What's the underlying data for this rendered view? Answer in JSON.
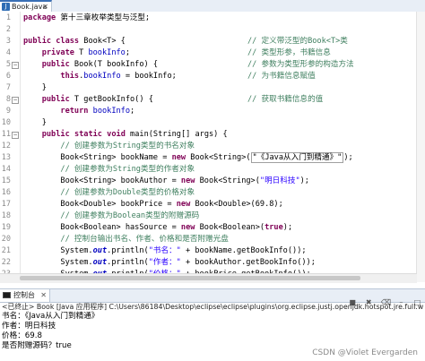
{
  "editor": {
    "tab_label": "Book.java",
    "tab_close": "✕",
    "highlighted_line": 27,
    "lines": [
      {
        "n": "1",
        "fold": "",
        "tokens": [
          {
            "t": "package",
            "c": "kw"
          },
          {
            "t": " 第十三章枚举类型与泛型;",
            "c": ""
          }
        ]
      },
      {
        "n": "2",
        "fold": "",
        "tokens": []
      },
      {
        "n": "3",
        "fold": "",
        "tokens": [
          {
            "t": "public",
            "c": "kw"
          },
          {
            "t": " ",
            "c": ""
          },
          {
            "t": "class",
            "c": "kw"
          },
          {
            "t": " Book<T> {",
            "c": ""
          }
        ],
        "comment": "// 定义带泛型的Book<T>类"
      },
      {
        "n": "4",
        "fold": "",
        "tokens": [
          {
            "t": "    ",
            "c": ""
          },
          {
            "t": "private",
            "c": "kw"
          },
          {
            "t": " T ",
            "c": ""
          },
          {
            "t": "bookInfo",
            "c": "field"
          },
          {
            "t": ";",
            "c": ""
          }
        ],
        "comment": "// 类型形参，书籍信息"
      },
      {
        "n": "5",
        "fold": "−",
        "tokens": [
          {
            "t": "    ",
            "c": ""
          },
          {
            "t": "public",
            "c": "kw"
          },
          {
            "t": " Book(T bookInfo) {",
            "c": ""
          }
        ],
        "comment": "// 参数为类型形参的构造方法"
      },
      {
        "n": "6",
        "fold": "",
        "tokens": [
          {
            "t": "        ",
            "c": ""
          },
          {
            "t": "this",
            "c": "kw"
          },
          {
            "t": ".",
            "c": ""
          },
          {
            "t": "bookInfo",
            "c": "field"
          },
          {
            "t": " = bookInfo;",
            "c": ""
          }
        ],
        "comment": "// 为书籍信息赋值"
      },
      {
        "n": "7",
        "fold": "",
        "tokens": [
          {
            "t": "    }",
            "c": ""
          }
        ]
      },
      {
        "n": "8",
        "fold": "−",
        "tokens": [
          {
            "t": "    ",
            "c": ""
          },
          {
            "t": "public",
            "c": "kw"
          },
          {
            "t": " T getBookInfo() {",
            "c": ""
          }
        ],
        "comment": "// 获取书籍信息的值"
      },
      {
        "n": "9",
        "fold": "",
        "tokens": [
          {
            "t": "        ",
            "c": ""
          },
          {
            "t": "return",
            "c": "kw"
          },
          {
            "t": " ",
            "c": ""
          },
          {
            "t": "bookInfo",
            "c": "field"
          },
          {
            "t": ";",
            "c": ""
          }
        ]
      },
      {
        "n": "10",
        "fold": "",
        "tokens": [
          {
            "t": "    }",
            "c": ""
          }
        ]
      },
      {
        "n": "11",
        "fold": "−",
        "tokens": [
          {
            "t": "    ",
            "c": ""
          },
          {
            "t": "public",
            "c": "kw"
          },
          {
            "t": " ",
            "c": ""
          },
          {
            "t": "static",
            "c": "kw"
          },
          {
            "t": " ",
            "c": ""
          },
          {
            "t": "void",
            "c": "kw"
          },
          {
            "t": " main(String[] args) {",
            "c": ""
          }
        ]
      },
      {
        "n": "12",
        "fold": "",
        "tokens": [
          {
            "t": "        // 创建参数为String类型的书名对象",
            "c": "cm"
          }
        ]
      },
      {
        "n": "13",
        "fold": "",
        "tokens": [
          {
            "t": "        Book<String> bookName = ",
            "c": ""
          },
          {
            "t": "new",
            "c": "kw"
          },
          {
            "t": " Book<String>(",
            "c": ""
          },
          {
            "t": "\"《Java从入门到精通》\"",
            "c": "strbox"
          },
          {
            "t": ");",
            "c": ""
          }
        ]
      },
      {
        "n": "14",
        "fold": "",
        "tokens": [
          {
            "t": "        // 创建参数为String类型的作者对象",
            "c": "cm"
          }
        ]
      },
      {
        "n": "15",
        "fold": "",
        "tokens": [
          {
            "t": "        Book<String> bookAuthor = ",
            "c": ""
          },
          {
            "t": "new",
            "c": "kw"
          },
          {
            "t": " Book<String>(",
            "c": ""
          },
          {
            "t": "\"明日科技\"",
            "c": "str"
          },
          {
            "t": ");",
            "c": ""
          }
        ]
      },
      {
        "n": "16",
        "fold": "",
        "tokens": [
          {
            "t": "        // 创建参数为Double类型的价格对象",
            "c": "cm"
          }
        ]
      },
      {
        "n": "17",
        "fold": "",
        "tokens": [
          {
            "t": "        Book<Double> bookPrice = ",
            "c": ""
          },
          {
            "t": "new",
            "c": "kw"
          },
          {
            "t": " Book<Double>(69.8);",
            "c": ""
          }
        ]
      },
      {
        "n": "18",
        "fold": "",
        "tokens": [
          {
            "t": "        // 创建参数为Boolean类型的附赠源码",
            "c": "cm"
          }
        ]
      },
      {
        "n": "19",
        "fold": "",
        "tokens": [
          {
            "t": "        Book<Boolean> hasSource = ",
            "c": ""
          },
          {
            "t": "new",
            "c": "kw"
          },
          {
            "t": " Book<Boolean>(",
            "c": ""
          },
          {
            "t": "true",
            "c": "kw"
          },
          {
            "t": ");",
            "c": ""
          }
        ]
      },
      {
        "n": "20",
        "fold": "",
        "tokens": [
          {
            "t": "        // 控制台输出书名、作者、价格和是否附赠光盘",
            "c": "cm"
          }
        ]
      },
      {
        "n": "21",
        "fold": "",
        "tokens": [
          {
            "t": "        System.",
            "c": ""
          },
          {
            "t": "out",
            "c": "stat"
          },
          {
            "t": ".println(",
            "c": ""
          },
          {
            "t": "\"书名：\"",
            "c": "str"
          },
          {
            "t": " + bookName.getBookInfo());",
            "c": ""
          }
        ]
      },
      {
        "n": "22",
        "fold": "",
        "tokens": [
          {
            "t": "        System.",
            "c": ""
          },
          {
            "t": "out",
            "c": "stat"
          },
          {
            "t": ".println(",
            "c": ""
          },
          {
            "t": "\"作者：\"",
            "c": "str"
          },
          {
            "t": " + bookAuthor.getBookInfo());",
            "c": ""
          }
        ]
      },
      {
        "n": "23",
        "fold": "",
        "tokens": [
          {
            "t": "        System.",
            "c": ""
          },
          {
            "t": "out",
            "c": "stat"
          },
          {
            "t": ".println(",
            "c": ""
          },
          {
            "t": "\"价格：\"",
            "c": "str"
          },
          {
            "t": " + bookPrice.getBookInfo());",
            "c": ""
          }
        ]
      },
      {
        "n": "24",
        "fold": "",
        "tokens": [
          {
            "t": "        System.",
            "c": ""
          },
          {
            "t": "out",
            "c": "stat"
          },
          {
            "t": ".println(",
            "c": ""
          },
          {
            "t": "\"是否附赠源码？\"",
            "c": "str"
          },
          {
            "t": " + hasSource.getBookInfo());",
            "c": ""
          }
        ]
      },
      {
        "n": "25",
        "fold": "",
        "tokens": [
          {
            "t": "    }",
            "c": ""
          }
        ]
      },
      {
        "n": "26",
        "fold": "",
        "tokens": [
          {
            "t": "}",
            "c": ""
          }
        ]
      },
      {
        "n": "27",
        "fold": "",
        "tokens": []
      }
    ]
  },
  "console": {
    "tab_label": "控制台",
    "tab_close": "✕",
    "header": "<已终止> Book [Java 应用程序] C:\\Users\\86184\\Desktop\\eclipse\\eclipse\\plugins\\org.eclipse.justj.openjdk.hotspot.jre.full.win32.x86_64",
    "output": [
      "书名：《Java从入门到精通》",
      "作者：明日科技",
      "价格：69.8",
      "是否附赠源码？true"
    ]
  },
  "watermark": "CSDN @Violet Evergarden",
  "icons": [
    "java-file-icon",
    "console-icon",
    "terminate-icon",
    "remove-launch-icon",
    "clear-console-icon",
    "minimize-icon",
    "maximize-icon"
  ]
}
